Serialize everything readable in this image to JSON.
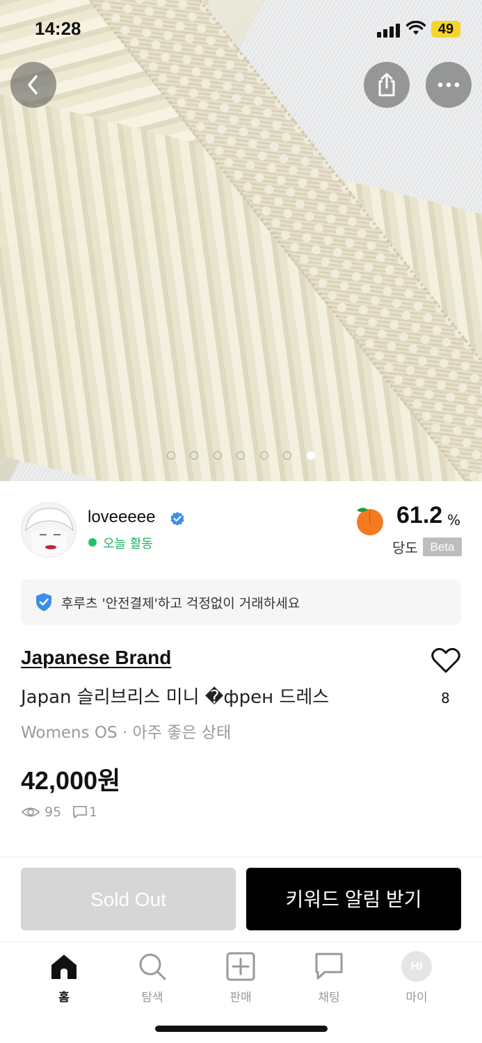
{
  "status_bar": {
    "time": "14:28",
    "battery": "49"
  },
  "image_carousel": {
    "total": 7,
    "active_index": 6
  },
  "seller": {
    "name": "loveeeee",
    "activity": "오늘 활동",
    "score": "61.2",
    "score_unit": "%",
    "score_label": "당도",
    "beta_badge": "Beta"
  },
  "safe_payment": {
    "text": "후루츠 '안전결제'하고 걱정없이 거래하세요"
  },
  "product": {
    "brand": "Japanese Brand",
    "title": "Japan 슬리브리스 미니 �френ 드레스",
    "meta": "Womens OS · 아주 좋은 상태",
    "price": "42,000원",
    "like_count": "8",
    "views": "95",
    "chats": "1"
  },
  "actions": {
    "sold_out_label": "Sold Out",
    "keyword_alert_label": "키워드 알림 받기"
  },
  "tab_bar": {
    "items": [
      {
        "label": "홈",
        "icon": "home-icon",
        "active": true
      },
      {
        "label": "탐색",
        "icon": "search-icon",
        "active": false
      },
      {
        "label": "판매",
        "icon": "plus-square-icon",
        "active": false
      },
      {
        "label": "채팅",
        "icon": "chat-bubble-icon",
        "active": false
      },
      {
        "label": "마이",
        "icon": "profile-avatar",
        "active": false
      }
    ],
    "avatar_initials": "HI"
  },
  "colors": {
    "accent_green": "#1fc46a",
    "verified_blue": "#3b8eea",
    "primary_button": "#000000",
    "disabled_button": "#d6d6d6"
  }
}
